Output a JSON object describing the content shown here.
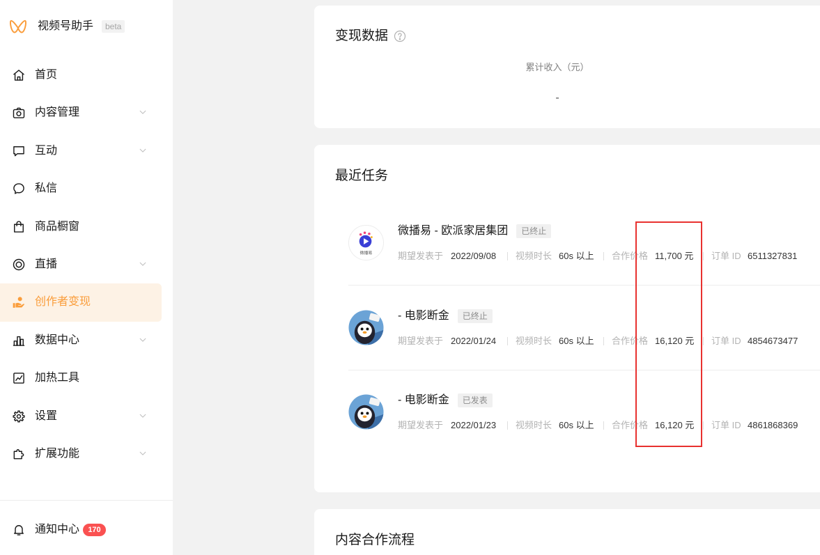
{
  "app": {
    "name": "视频号助手",
    "beta_label": "beta",
    "logo_icon": "wechat-channels-logo-icon",
    "accent_color": "#fa9d3b"
  },
  "sidebar": {
    "items": [
      {
        "label": "首页",
        "icon": "home-icon",
        "has_submenu": false,
        "active": false
      },
      {
        "label": "内容管理",
        "icon": "camera-icon",
        "has_submenu": true,
        "active": false
      },
      {
        "label": "互动",
        "icon": "message-square-icon",
        "has_submenu": true,
        "active": false
      },
      {
        "label": "私信",
        "icon": "chat-bubble-icon",
        "has_submenu": false,
        "active": false
      },
      {
        "label": "商品橱窗",
        "icon": "shopping-bag-icon",
        "has_submenu": false,
        "active": false
      },
      {
        "label": "直播",
        "icon": "live-icon",
        "has_submenu": true,
        "active": false
      },
      {
        "label": "创作者变现",
        "icon": "creator-monetization-icon",
        "has_submenu": false,
        "active": true
      },
      {
        "label": "数据中心",
        "icon": "bar-chart-icon",
        "has_submenu": true,
        "active": false
      },
      {
        "label": "加热工具",
        "icon": "trending-icon",
        "has_submenu": false,
        "active": false
      },
      {
        "label": "设置",
        "icon": "gear-icon",
        "has_submenu": true,
        "active": false
      },
      {
        "label": "扩展功能",
        "icon": "puzzle-icon",
        "has_submenu": true,
        "active": false
      }
    ],
    "notification": {
      "label": "通知中心",
      "icon": "bell-icon",
      "count": "170",
      "badge_color": "#fa5151"
    }
  },
  "monetization_card": {
    "title": "变现数据",
    "help_icon": "question-circle-icon",
    "income_label": "累计收入（元）",
    "income_value": "-"
  },
  "tasks_card": {
    "title": "最近任务",
    "field_labels": {
      "publish_date": "期望发表于",
      "video_duration": "视频时长",
      "price": "合作价格",
      "order_id": "订单 ID"
    },
    "tasks": [
      {
        "name": "微播易 - 欧派家居集团",
        "status": "已终止",
        "publish_date": "2022/09/08",
        "video_duration": "60s 以上",
        "price": "11,700 元",
        "order_id": "6511327831",
        "avatar": {
          "icon": "weiboyi-logo-icon",
          "logo_text": "微播易"
        }
      },
      {
        "name": "- 电影断金",
        "status": "已终止",
        "publish_date": "2022/01/24",
        "video_duration": "60s 以上",
        "price": "16,120 元",
        "order_id": "4854673477",
        "avatar": {
          "icon": "penguin-avatar-icon"
        }
      },
      {
        "name": "- 电影断金",
        "status": "已发表",
        "publish_date": "2022/01/23",
        "video_duration": "60s 以上",
        "price": "16,120 元",
        "order_id": "4861868369",
        "avatar": {
          "icon": "penguin-avatar-icon"
        }
      }
    ]
  },
  "process_card": {
    "title": "内容合作流程"
  },
  "annotation": {
    "highlight_color": "#e8312f"
  }
}
